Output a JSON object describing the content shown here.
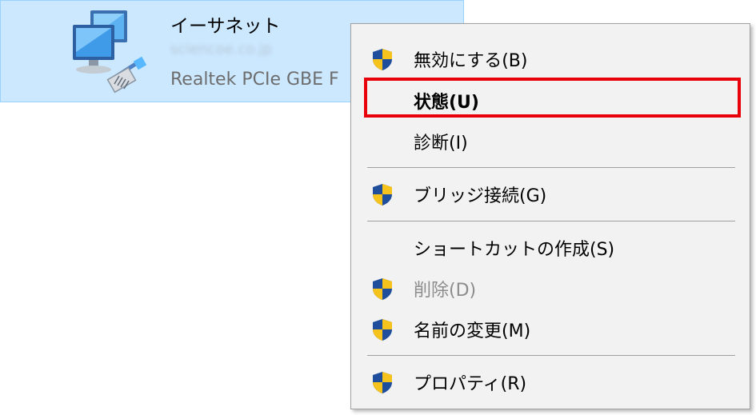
{
  "adapter": {
    "name": "イーサネット",
    "network": "sciencoe.co.jp",
    "device": "Realtek PCIe GBE F",
    "icon": "network-adapter-icon"
  },
  "menu": {
    "items": [
      {
        "label": "無効にする(B)",
        "shield": true,
        "bold": false,
        "disabled": false
      },
      {
        "label": "状態(U)",
        "shield": false,
        "bold": true,
        "disabled": false
      },
      {
        "label": "診断(I)",
        "shield": false,
        "bold": false,
        "disabled": false
      },
      {
        "label": "ブリッジ接続(G)",
        "shield": true,
        "bold": false,
        "disabled": false
      },
      {
        "label": "ショートカットの作成(S)",
        "shield": false,
        "bold": false,
        "disabled": false
      },
      {
        "label": "削除(D)",
        "shield": true,
        "bold": false,
        "disabled": true
      },
      {
        "label": "名前の変更(M)",
        "shield": true,
        "bold": false,
        "disabled": false
      },
      {
        "label": "プロパティ(R)",
        "shield": true,
        "bold": false,
        "disabled": false
      }
    ],
    "highlighted_item": "状態(U)"
  },
  "colors": {
    "selection_bg": "#cce8ff",
    "menu_bg": "#f2f2f2",
    "highlight_border": "#e8000b",
    "shield_blue": "#1f4e9c",
    "shield_yellow": "#f6c31c"
  }
}
